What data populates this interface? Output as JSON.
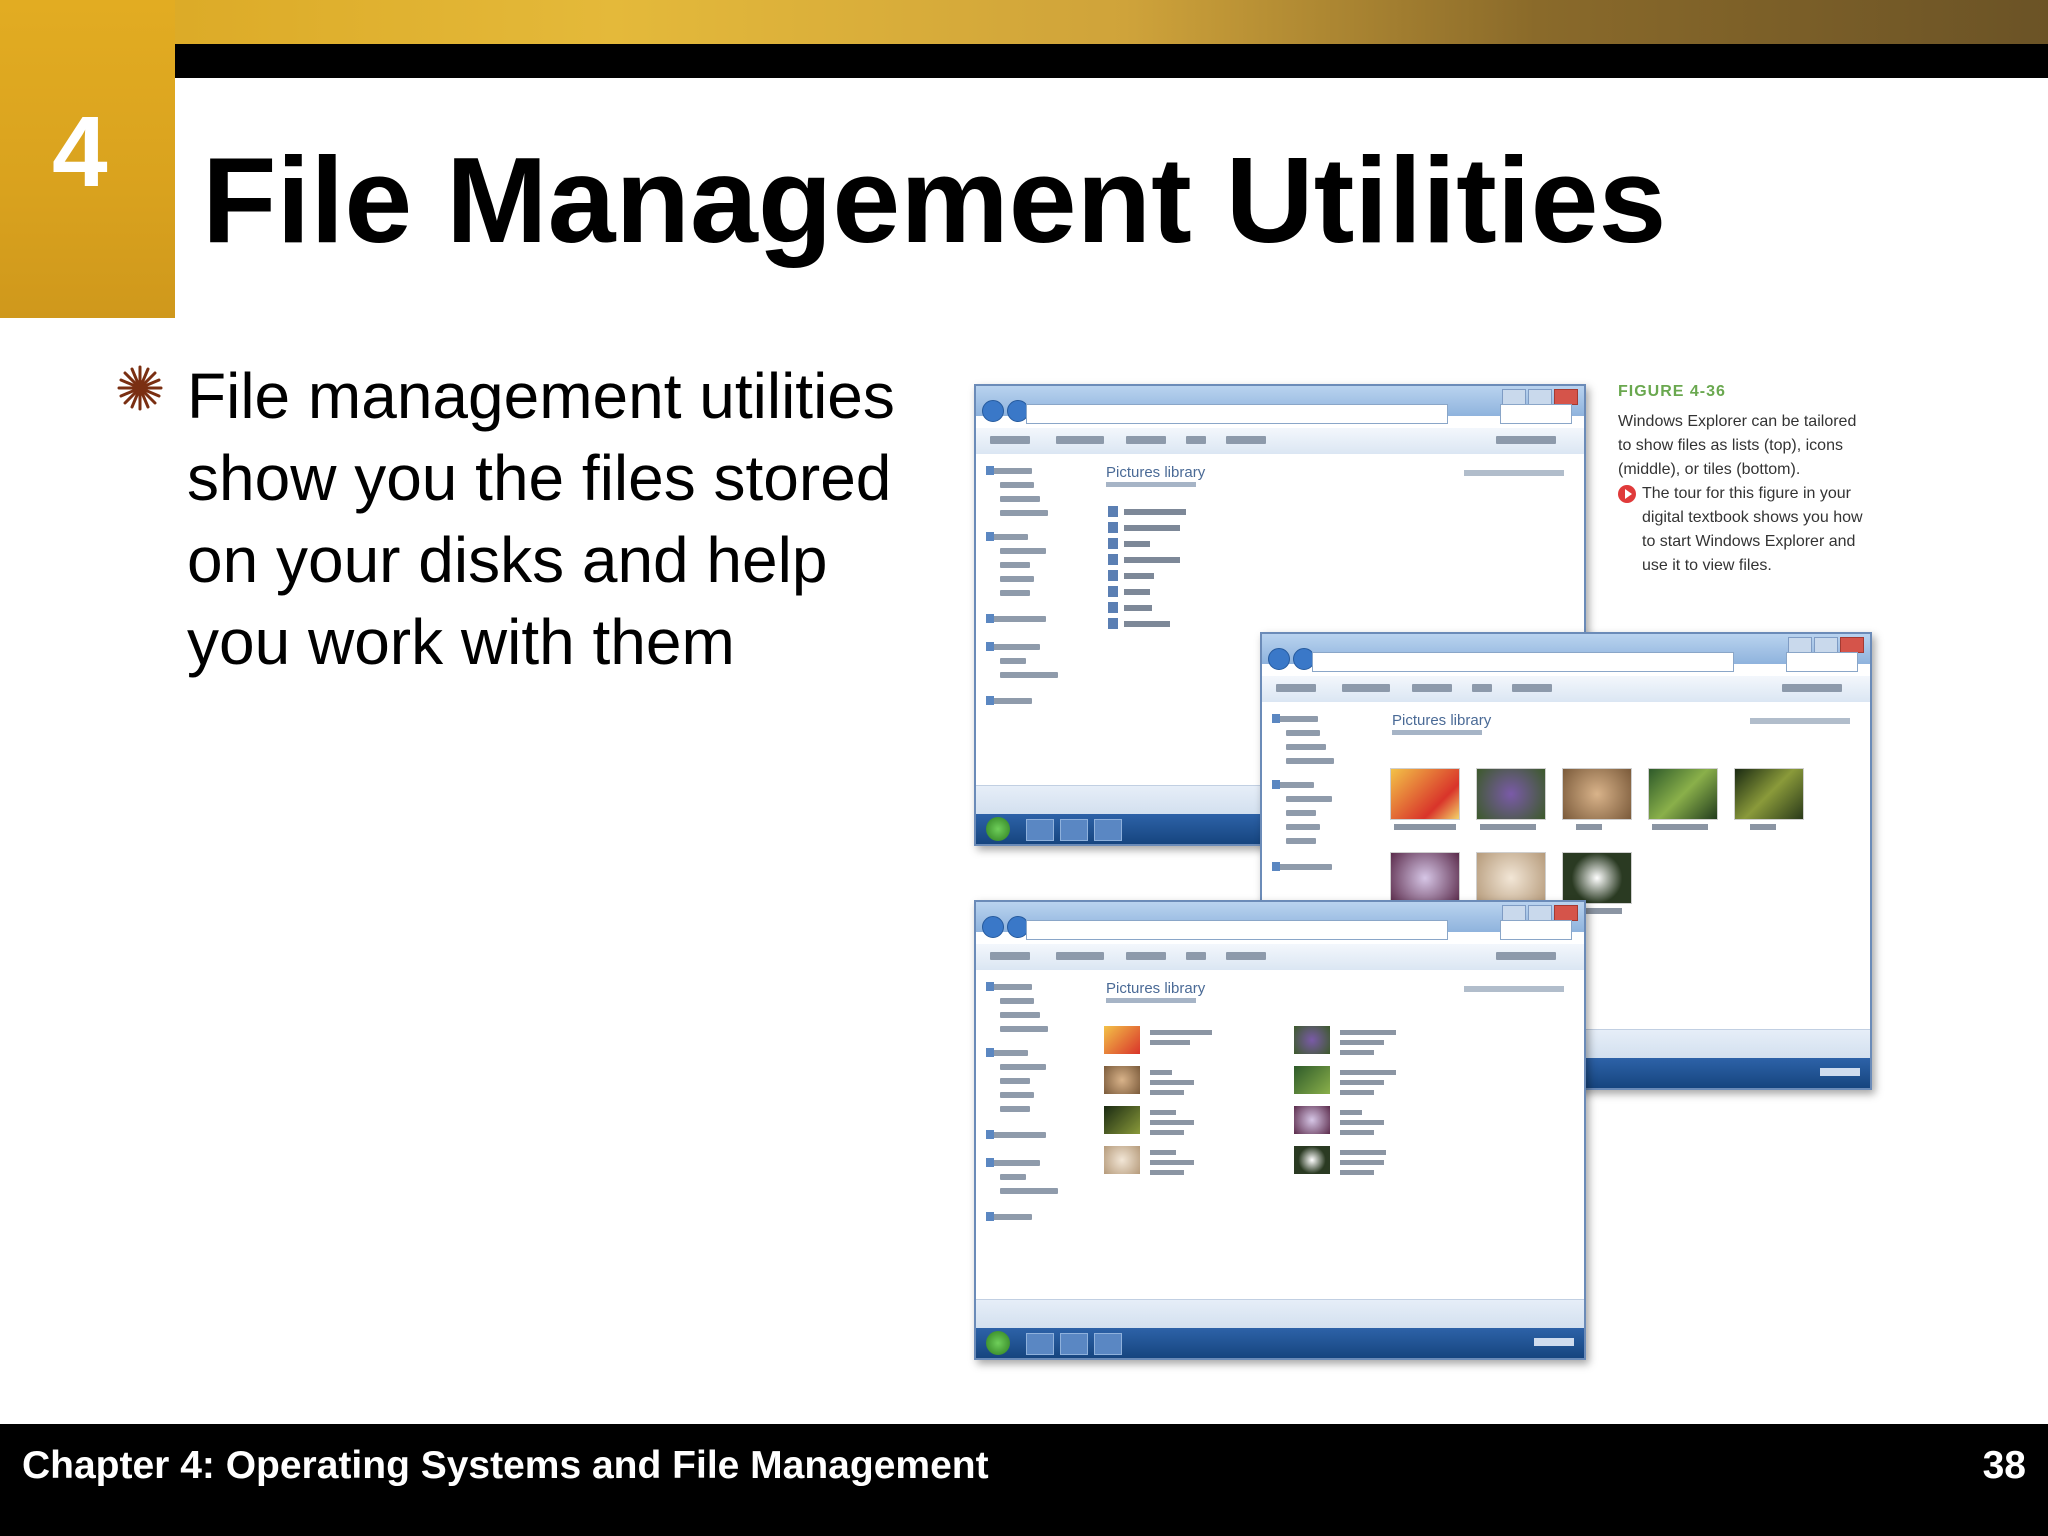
{
  "header": {
    "chapter_number": "4",
    "title": "File Management Utilities"
  },
  "bullets": [
    {
      "text": "File management utilities show you the files stored on your disks and help you work with them"
    }
  ],
  "figure": {
    "label": "FIGURE 4-36",
    "caption": "Windows Explorer can be tailored to show files as lists (top), icons (middle), or tiles (bottom).",
    "tour_note": "The tour for this figure in your digital textbook shows you how to start Windows Explorer and use it to view files.",
    "library_title": "Pictures library"
  },
  "footer": {
    "chapter": "Chapter 4: Operating Systems and File Management",
    "page_number": "38"
  },
  "colors": {
    "accent": "#dba621",
    "bar": "#000000",
    "bullet": "#7a2f12",
    "figure_label": "#6aa84f"
  }
}
